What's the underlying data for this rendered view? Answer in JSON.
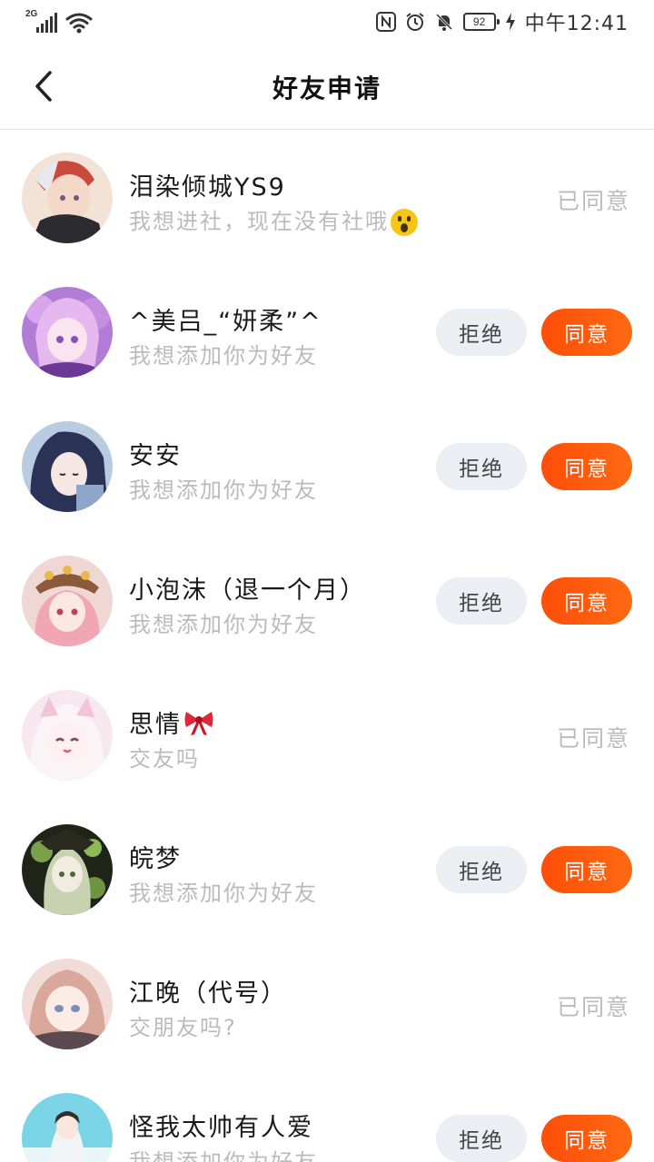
{
  "status_bar": {
    "network_type": "2G",
    "battery_level": "92",
    "time": "中午12:41",
    "icons": [
      "signal-icon",
      "wifi-icon",
      "nfc-icon",
      "alarm-icon",
      "mute-icon",
      "battery-icon",
      "charging-icon"
    ]
  },
  "header": {
    "title": "好友申请",
    "back_icon": "back-arrow-icon"
  },
  "buttons": {
    "reject_label": "拒绝",
    "agree_label": "同意"
  },
  "colors": {
    "agree_button": "#ff5a0f",
    "reject_button": "#edeef3",
    "secondary_text": "#bbbbbb"
  },
  "requests": [
    {
      "name": "泪染倾城YS9",
      "message": "我想进社，现在没有社哦",
      "message_emoji": "astonished-face-emoji",
      "status": "已同意",
      "pending": false
    },
    {
      "name": "^美吕_“妍柔”^",
      "message": "我想添加你为好友",
      "status": "",
      "pending": true
    },
    {
      "name": "安安",
      "message": "我想添加你为好友",
      "status": "",
      "pending": true
    },
    {
      "name": "小泡沫（退一个月）",
      "message": "我想添加你为好友",
      "status": "",
      "pending": true
    },
    {
      "name": "思情",
      "name_emoji": "ribbon-emoji",
      "message": "交友吗",
      "status": "已同意",
      "pending": false
    },
    {
      "name": "皖梦",
      "message": "我想添加你为好友",
      "status": "",
      "pending": true
    },
    {
      "name": "江晚（代号）",
      "message": "交朋友吗?",
      "status": "已同意",
      "pending": false
    },
    {
      "name": "怪我太帅有人爱",
      "message": "我想添加你为好友",
      "status": "",
      "pending": true
    }
  ]
}
